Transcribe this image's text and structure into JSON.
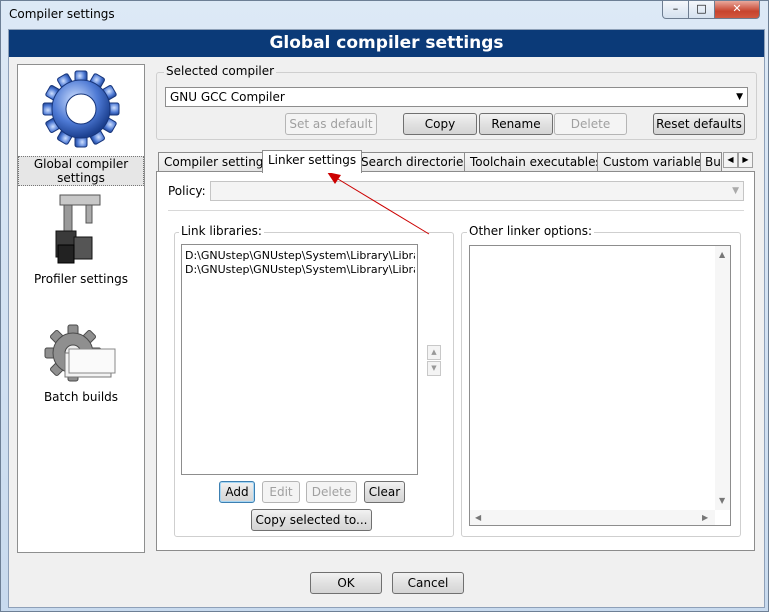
{
  "window": {
    "title": "Compiler settings",
    "banner": "Global compiler settings"
  },
  "caption_buttons": {
    "minimize": "–",
    "maximize": "□",
    "close": "✕"
  },
  "sidebar": {
    "items": [
      {
        "label": "Global compiler settings",
        "icon": "gear-icon",
        "selected": true
      },
      {
        "label": "Profiler settings",
        "icon": "caliper-icon",
        "selected": false
      },
      {
        "label": "Batch builds",
        "icon": "batch-gear-icon",
        "selected": false
      }
    ]
  },
  "selected_compiler": {
    "group_label": "Selected compiler",
    "value": "GNU GCC Compiler",
    "buttons": {
      "set_default": "Set as default",
      "copy": "Copy",
      "rename": "Rename",
      "delete": "Delete",
      "reset": "Reset defaults"
    }
  },
  "tabs": [
    {
      "label": "Compiler settings"
    },
    {
      "label": "Linker settings"
    },
    {
      "label": "Search directories"
    },
    {
      "label": "Toolchain executables"
    },
    {
      "label": "Custom variables"
    },
    {
      "label": "Bui"
    }
  ],
  "linker": {
    "policy_label": "Policy:",
    "policy_value": "",
    "link_libraries_label": "Link libraries:",
    "libraries": [
      "D:\\GNUstep\\GNUstep\\System\\Library\\Libra",
      "D:\\GNUstep\\GNUstep\\System\\Library\\Libra"
    ],
    "buttons": {
      "add": "Add",
      "edit": "Edit",
      "delete": "Delete",
      "clear": "Clear",
      "copy_selected": "Copy selected to..."
    },
    "other_options_label": "Other linker options:",
    "other_options_value": ""
  },
  "dialog": {
    "ok": "OK",
    "cancel": "Cancel"
  },
  "colors": {
    "banner": "#0b3a78",
    "annotation_arrow": "#cc0000"
  }
}
